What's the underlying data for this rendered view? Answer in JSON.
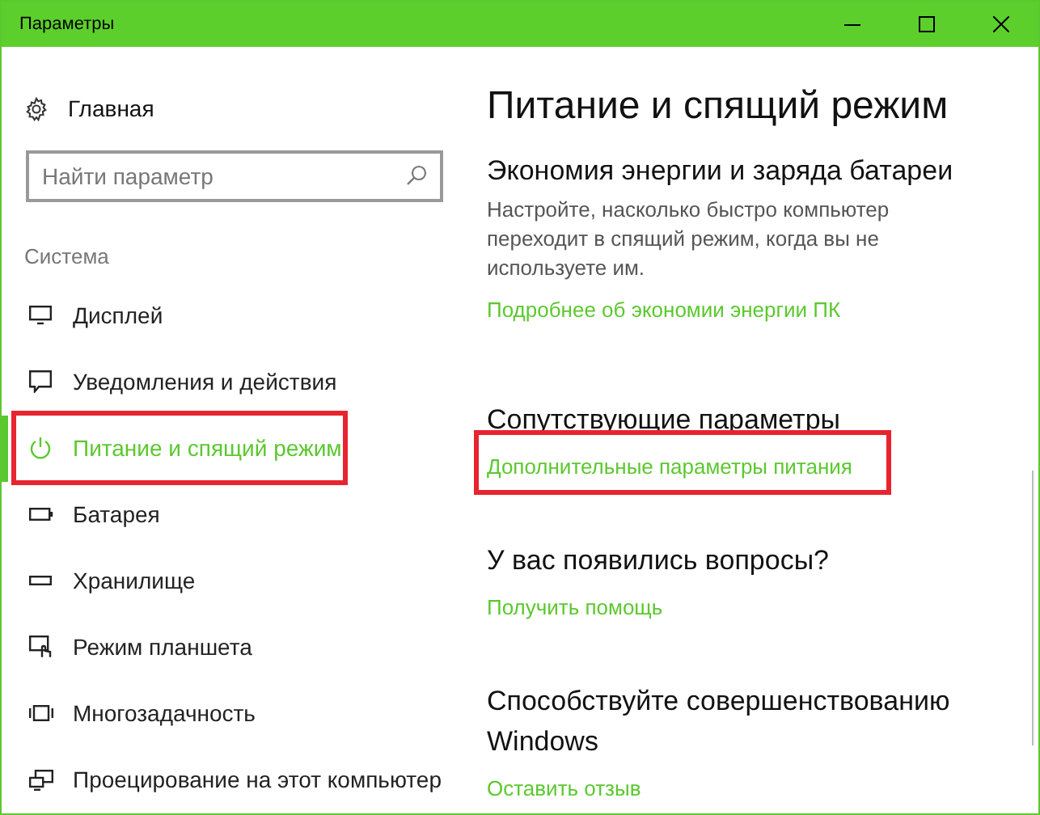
{
  "window": {
    "title": "Параметры"
  },
  "sidebar": {
    "home": "Главная",
    "search": {
      "placeholder": "Найти параметр"
    },
    "section": "Система",
    "items": [
      {
        "label": "Дисплей",
        "kind": "display",
        "selected": false,
        "highlighted": false
      },
      {
        "label": "Уведомления и действия",
        "kind": "notifications",
        "selected": false,
        "highlighted": false
      },
      {
        "label": "Питание и спящий режим",
        "kind": "power",
        "selected": true,
        "highlighted": true
      },
      {
        "label": "Батарея",
        "kind": "battery",
        "selected": false,
        "highlighted": false
      },
      {
        "label": "Хранилище",
        "kind": "storage",
        "selected": false,
        "highlighted": false
      },
      {
        "label": "Режим планшета",
        "kind": "tablet",
        "selected": false,
        "highlighted": false
      },
      {
        "label": "Многозадачность",
        "kind": "multitask",
        "selected": false,
        "highlighted": false
      },
      {
        "label": "Проецирование на этот компьютер",
        "kind": "project",
        "selected": false,
        "highlighted": false
      }
    ]
  },
  "content": {
    "title": "Питание и спящий режим",
    "sections": [
      {
        "heading": "Экономия энергии и заряда батареи",
        "text": "Настройте, насколько быстро компьютер переходит в спящий режим, когда вы не используете им.",
        "link": "Подробнее об экономии энергии ПК",
        "highlighted": false
      },
      {
        "heading": "Сопутствующие параметры",
        "link": "Дополнительные параметры питания",
        "highlighted": true
      },
      {
        "heading": "У вас появились вопросы?",
        "link": "Получить помощь",
        "highlighted": false
      },
      {
        "heading": "Способствуйте совершенствованию Windows",
        "link": "Оставить отзыв",
        "highlighted": false
      }
    ]
  }
}
